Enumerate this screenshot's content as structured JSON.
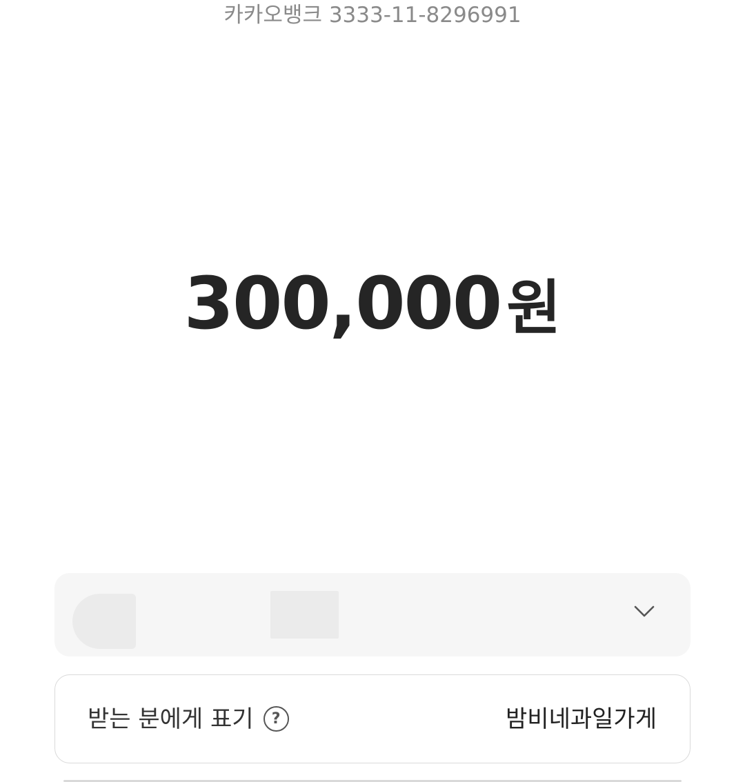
{
  "header": {
    "bank_account": "카카오뱅크 3333-11-8296991"
  },
  "transfer": {
    "amount": "300,000",
    "currency_unit": "원"
  },
  "source_account": {
    "icon": "chevron-down-icon"
  },
  "memo": {
    "label": "받는 분에게 표기",
    "help_icon_glyph": "?",
    "value": "밤비네과일가게"
  },
  "colors": {
    "background": "#ffffff",
    "muted_text": "#8a8a8a",
    "amount_text": "#252525",
    "select_bg": "#f6f6f6",
    "border": "#d9d9d9"
  }
}
